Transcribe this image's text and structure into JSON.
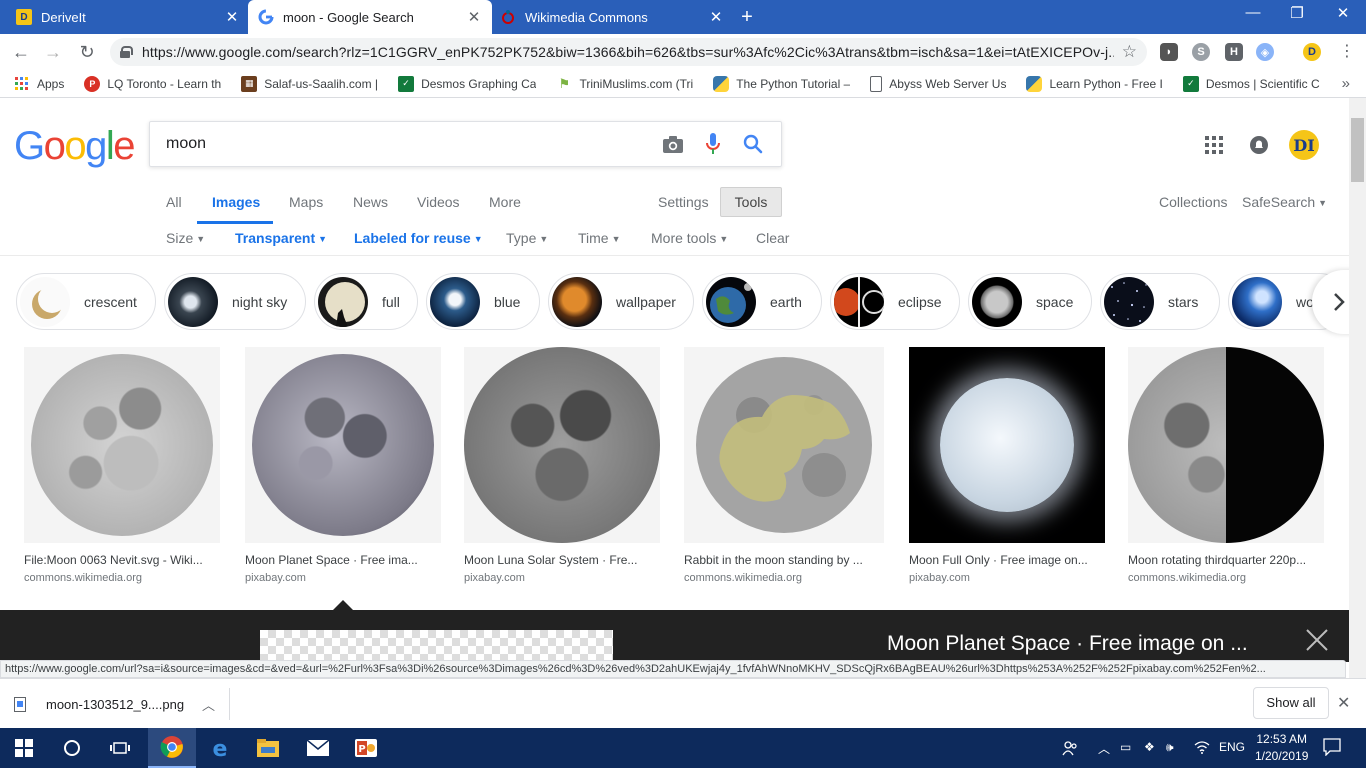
{
  "browser": {
    "tabs": [
      {
        "title": "DeriveIt",
        "favicon": "D"
      },
      {
        "title": "moon - Google Search",
        "favicon": "G"
      },
      {
        "title": "Wikimedia Commons",
        "favicon": "W"
      }
    ],
    "url": "https://www.google.com/search?rlz=1C1GGRV_enPK752PK752&biw=1366&bih=626&tbs=sur%3Afc%2Cic%3Atrans&tbm=isch&sa=1&ei=tAtEXICEPOv-j...",
    "bookmarks": [
      {
        "label": "Apps"
      },
      {
        "label": "LQ Toronto - Learn th"
      },
      {
        "label": "Salaf-us-Saalih.com |"
      },
      {
        "label": "Desmos Graphing Ca"
      },
      {
        "label": "TriniMuslims.com (Tri"
      },
      {
        "label": "The Python Tutorial –"
      },
      {
        "label": "Abyss Web Server Us"
      },
      {
        "label": "Learn Python - Free I"
      },
      {
        "label": "Desmos | Scientific C"
      }
    ]
  },
  "search": {
    "query": "moon",
    "nav_tabs": [
      "All",
      "Images",
      "Maps",
      "News",
      "Videos",
      "More",
      "Settings",
      "Tools"
    ],
    "right_links": {
      "collections": "Collections",
      "safesearch": "SafeSearch"
    },
    "filters": {
      "size": "Size",
      "color": "Transparent",
      "rights": "Labeled for reuse",
      "type": "Type",
      "time": "Time",
      "more_tools": "More tools",
      "clear": "Clear"
    },
    "chips": [
      "crescent",
      "night sky",
      "full",
      "blue",
      "wallpaper",
      "earth",
      "eclipse",
      "space",
      "stars",
      "wol"
    ]
  },
  "results": [
    {
      "title": "File:Moon 0063 Nevit.svg - Wiki...",
      "source": "commons.wikimedia.org"
    },
    {
      "title": "Moon Planet Space · Free ima...",
      "source": "pixabay.com"
    },
    {
      "title": "Moon Luna Solar System · Fre...",
      "source": "pixabay.com"
    },
    {
      "title": "Rabbit in the moon standing by ...",
      "source": "commons.wikimedia.org"
    },
    {
      "title": "Moon Full Only · Free image on...",
      "source": "pixabay.com"
    },
    {
      "title": "Moon rotating thirdquarter 220p...",
      "source": "commons.wikimedia.org"
    }
  ],
  "preview": {
    "title": "Moon Planet Space · Free image on ..."
  },
  "status_url": "https://www.google.com/url?sa=i&source=images&cd=&ved=&url=%2Furl%3Fsa%3Di%26source%3Dimages%26cd%3D%26ved%3D2ahUKEwjaj4y_1fvfAhWNnoMKHV_SDScQjRx6BAgBEAU%26url%3Dhttps%253A%252F%252Fpixabay.com%252Fen%2...",
  "download": {
    "filename": "moon-1303512_9....png",
    "show_all": "Show all"
  },
  "taskbar": {
    "language": "ENG",
    "time": "12:53 AM",
    "date": "1/20/2019"
  },
  "colors": {
    "chrome_blue": "#2a5fb9",
    "google_blue": "#1a73e8",
    "taskbar": "#0d2a5c"
  }
}
